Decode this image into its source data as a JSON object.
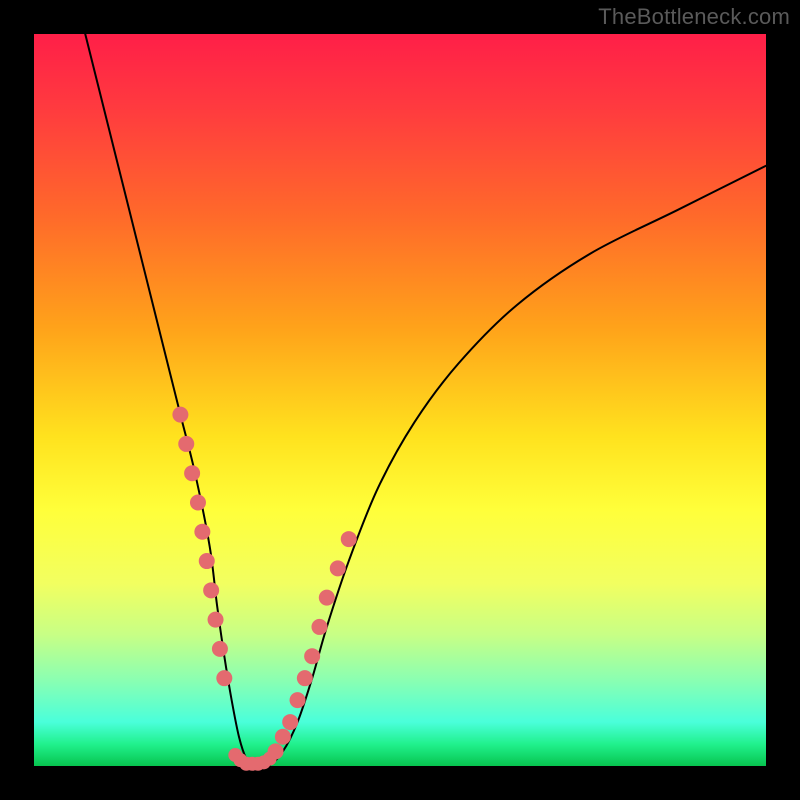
{
  "watermark": "TheBottleneck.com",
  "chart_data": {
    "type": "line",
    "title": "",
    "xlabel": "",
    "ylabel": "",
    "xlim": [
      0,
      100
    ],
    "ylim": [
      0,
      100
    ],
    "series": [
      {
        "name": "curve",
        "x": [
          7,
          10,
          12,
          14,
          16,
          18,
          20,
          22,
          24,
          25,
          26,
          27,
          28,
          29,
          30,
          32,
          34,
          36,
          38,
          40,
          43,
          47,
          52,
          58,
          66,
          76,
          88,
          100
        ],
        "values": [
          100,
          88,
          80,
          72,
          64,
          56,
          48,
          40,
          30,
          22,
          15,
          9,
          4,
          1,
          0,
          0,
          2,
          6,
          12,
          19,
          28,
          38,
          47,
          55,
          63,
          70,
          76,
          82
        ]
      }
    ],
    "markers": {
      "left_cluster": {
        "x": [
          20.0,
          20.8,
          21.6,
          22.4,
          23.0,
          23.6,
          24.2,
          24.8,
          25.4,
          26.0
        ],
        "values": [
          48,
          44,
          40,
          36,
          32,
          28,
          24,
          20,
          16,
          12
        ]
      },
      "right_cluster": {
        "x": [
          33.0,
          34.0,
          35.0,
          36.0,
          37.0,
          38.0,
          39.0,
          40.0,
          41.5,
          43.0
        ],
        "values": [
          2,
          4,
          6,
          9,
          12,
          15,
          19,
          23,
          27,
          31
        ]
      },
      "bottom_cluster": {
        "x": [
          27.5,
          28.2,
          29.0,
          29.8,
          30.6,
          31.4,
          32.2
        ],
        "values": [
          1.5,
          0.8,
          0.3,
          0.3,
          0.3,
          0.5,
          1.0
        ]
      }
    },
    "colors": {
      "curve": "#000000",
      "marker": "#e46a6f",
      "background_top": "#ff1f48",
      "background_bottom": "#07c44f"
    }
  }
}
